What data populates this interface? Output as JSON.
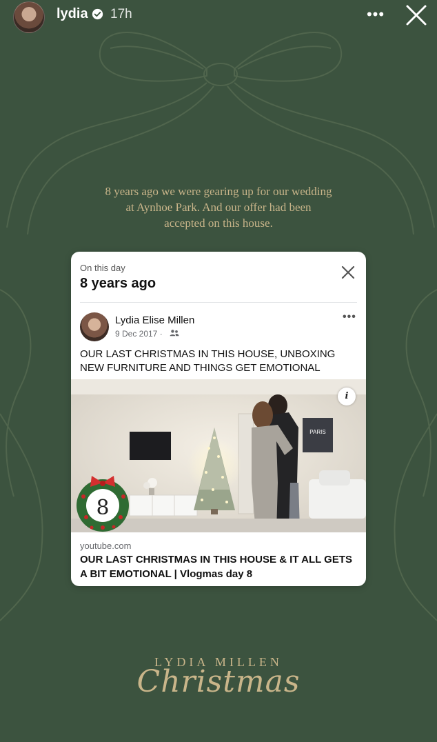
{
  "header": {
    "username": "lydia",
    "time": "17h"
  },
  "caption": "8 years ago we were gearing up for our wedding\nat Aynhoe Park. And our offer had been\naccepted on this house.",
  "memory": {
    "label": "On this day",
    "title": "8 years ago"
  },
  "post": {
    "author": "Lydia Elise Millen",
    "date": "9 Dec 2017 ·",
    "text": "OUR LAST CHRISTMAS IN THIS HOUSE, UNBOXING NEW FURNITURE AND THINGS GET EMOTIONAL",
    "media": {
      "wreath_number": "8",
      "poster_text": "PARIS"
    },
    "link": {
      "domain": "youtube.com",
      "title": "OUR LAST CHRISTMAS IN THIS HOUSE & IT ALL GETS A BIT EMOTIONAL | Vlogmas day 8"
    }
  },
  "branding": {
    "line1": "LYDIA MILLEN",
    "line2": "Christmas"
  },
  "colors": {
    "background": "#3c533f",
    "gold": "#c9b58a",
    "card": "#ffffff"
  }
}
